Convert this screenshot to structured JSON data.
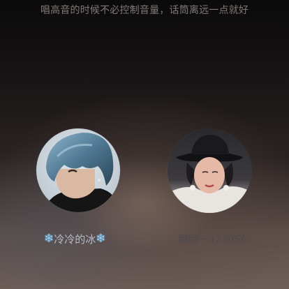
{
  "tip": {
    "text": "唱高音的时候不必控制音量，话筒离远一点就好"
  },
  "left_user": {
    "name": "冷冷的冰",
    "decoration_icon": "snowflake-icon"
  },
  "right_user": {
    "name": "顾顾一423056"
  }
}
